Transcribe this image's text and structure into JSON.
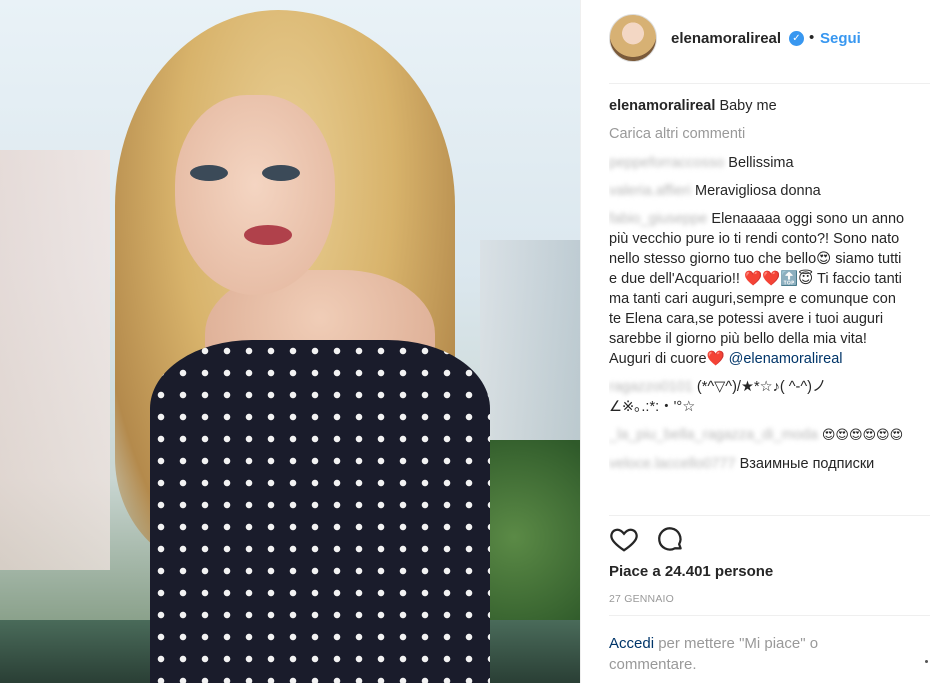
{
  "post": {
    "photo_alt": "elenamoralireal",
    "author": "elenamoralireal",
    "verified_symbol": "✓",
    "separator": "•",
    "follow_label": "Segui",
    "caption_user": "elenamoralireal",
    "caption_text": "Baby me",
    "load_more": "Carica altri commenti",
    "comments": [
      {
        "user": "peppeforraccosso",
        "text": "Bellissima"
      },
      {
        "user": "valeria.affieri",
        "text": "Meravigliosa donna"
      },
      {
        "user": "fabio_giuseppe",
        "text": "Elenaaaaa oggi sono un anno più vecchio pure io ti rendi conto?! Sono nato nello stesso giorno tuo che bello😍 siamo tutti e due dell'Acquario!! ❤️❤️🔝😇 Ti faccio tanti ma tanti cari auguri,sempre e comunque con te Elena cara,se potessi avere i tuoi auguri sarebbe il giorno più bello della mia vita! Auguri di cuore❤️",
        "mention": "@elenamoralireal"
      },
      {
        "user": "ragazzo0101",
        "text": "(*^▽^)/★*☆♪( ^-^)ノ∠※｡.:*:・'°☆"
      },
      {
        "user": "_la_piu_bella_ragazza_di_moda",
        "text": "😍😍😍😍😍😍"
      },
      {
        "user": "veloce.laccello0777",
        "text": "Взаимные подписки"
      }
    ],
    "likes_text": "Piace a 24.401 persone",
    "date": "27 GENNAIO",
    "footer_login": "Accedi",
    "footer_rest": " per mettere \"Mi piace\" o commentare.",
    "icons": {
      "like": "heart-icon",
      "comment": "comment-icon",
      "verified": "verified-badge-icon"
    },
    "colors": {
      "link": "#3897f0",
      "mention": "#003569",
      "muted": "#999999"
    }
  }
}
